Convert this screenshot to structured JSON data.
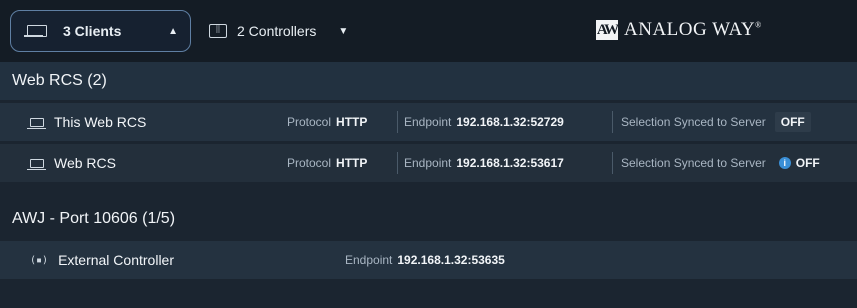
{
  "topbar": {
    "clients_tab": {
      "label": "3 Clients",
      "icon": "laptop-icon"
    },
    "controllers_tab": {
      "label": "2 Controllers",
      "icon": "controller-icon"
    },
    "logo": {
      "mark": "AW",
      "text": "ANALOG WAY",
      "reg": "®"
    }
  },
  "web_rcs": {
    "header": "Web RCS (2)",
    "rows": [
      {
        "name": "This Web RCS",
        "protocol_label": "Protocol",
        "protocol": "HTTP",
        "endpoint_label": "Endpoint",
        "endpoint": "192.168.1.32:52729",
        "sync_label": "Selection Synced to Server",
        "sync_value": "OFF"
      },
      {
        "name": "Web RCS",
        "protocol_label": "Protocol",
        "protocol": "HTTP",
        "endpoint_label": "Endpoint",
        "endpoint": "192.168.1.32:53617",
        "sync_label": "Selection Synced to Server",
        "sync_value": "OFF"
      }
    ]
  },
  "awj": {
    "header": "AWJ - Port 10606 (1/5)",
    "rows": [
      {
        "name": "External Controller",
        "icon_text": "(▪)",
        "endpoint_label": "Endpoint",
        "endpoint": "192.168.1.32:53635"
      }
    ]
  },
  "colors": {
    "background": "#1b2530",
    "topbar": "#141c25",
    "row": "#243240",
    "accent_border": "#5f7fa3",
    "info": "#3a8fd6"
  }
}
